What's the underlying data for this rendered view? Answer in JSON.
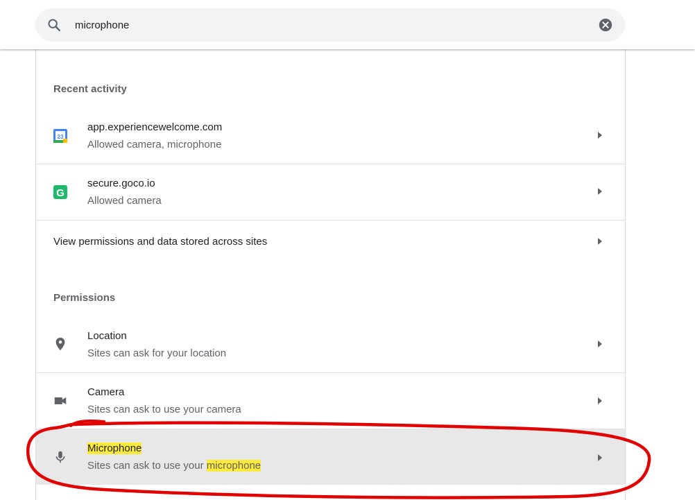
{
  "search": {
    "query": "microphone",
    "search_icon": "search-icon",
    "clear_icon": "clear-circle-icon"
  },
  "recent_activity": {
    "heading": "Recent activity",
    "items": [
      {
        "title": "app.experiencewelcome.com",
        "subtitle": "Allowed camera, microphone",
        "icon": "google-calendar-icon"
      },
      {
        "title": "secure.goco.io",
        "subtitle": "Allowed camera",
        "icon": "goco-g-icon"
      }
    ],
    "view_all_label": "View permissions and data stored across sites"
  },
  "permissions": {
    "heading": "Permissions",
    "items": [
      {
        "title": "Location",
        "subtitle": "Sites can ask for your location",
        "icon": "location-pin-icon"
      },
      {
        "title": "Camera",
        "subtitle": "Sites can ask to use your camera",
        "icon": "videocam-icon"
      },
      {
        "title": "Microphone",
        "subtitle_prefix": "Sites can ask to use your ",
        "subtitle_match": "microphone",
        "icon": "mic-icon"
      }
    ]
  },
  "colors": {
    "highlight": "#ffeb3b",
    "annotation": "#e00000",
    "selected_row": "#e8e8e8",
    "secondary_text": "#5f6368",
    "calendar_blue": "#4285f4",
    "goco_green": "#1eb86b"
  }
}
